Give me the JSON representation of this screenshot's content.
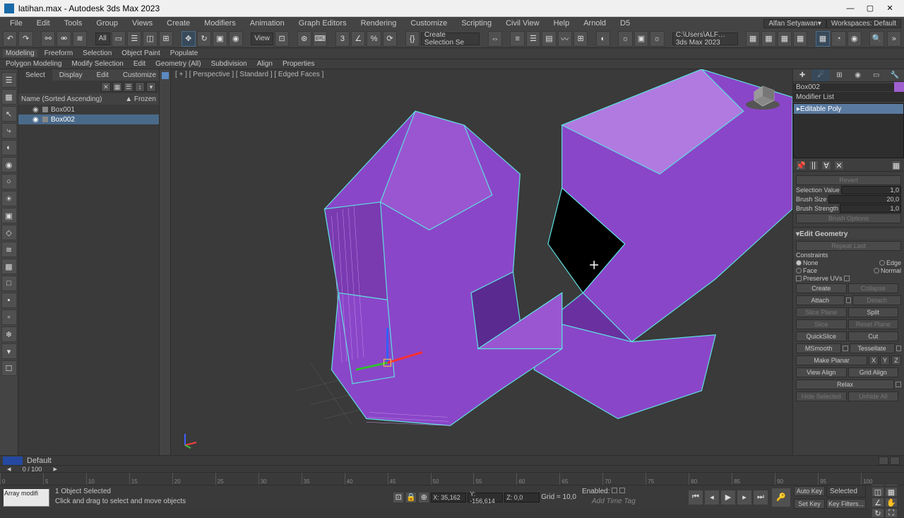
{
  "titlebar": {
    "title": "latihan.max - Autodesk 3ds Max 2023"
  },
  "menubar": {
    "items": [
      "File",
      "Edit",
      "Tools",
      "Group",
      "Views",
      "Create",
      "Modifiers",
      "Animation",
      "Graph Editors",
      "Rendering",
      "Customize",
      "Scripting",
      "Civil View",
      "Help",
      "Arnold",
      "D5"
    ],
    "user": "Alfan Setyawan",
    "workspace_label": "Workspaces:",
    "workspace_value": "Default"
  },
  "toolbar": {
    "filter_all": "All",
    "view": "View",
    "selection_set": "Create Selection Se",
    "path": "C:\\Users\\ALF… 3ds Max 2023"
  },
  "ribbon": {
    "tabs": [
      "Modeling",
      "Freeform",
      "Selection",
      "Object Paint",
      "Populate"
    ],
    "subtabs": [
      "Polygon Modeling",
      "Modify Selection",
      "Edit",
      "Geometry (All)",
      "Subdivision",
      "Align",
      "Properties"
    ]
  },
  "scene": {
    "tabs": [
      "Select",
      "Display",
      "Edit",
      "Customize"
    ],
    "header_name": "Name (Sorted Ascending)",
    "header_frozen": "▲ Frozen",
    "items": [
      {
        "name": "Box001",
        "selected": false
      },
      {
        "name": "Box002",
        "selected": true
      }
    ]
  },
  "viewport": {
    "label": "[ + ] [ Perspective ] [ Standard ] [ Edged Faces ]"
  },
  "modpanel": {
    "object_name": "Box002",
    "modlist_label": "Modifier List",
    "stack_item": "Editable Poly",
    "paint": {
      "revert": "Revert",
      "selval_label": "Selection Value",
      "selval": "1,0",
      "brushsize_label": "Brush Size",
      "brushsize": "20,0",
      "brushstr_label": "Brush Strength",
      "brushstr": "1,0",
      "brushopt": "Brush Options"
    },
    "editgeo": {
      "title": "Edit Geometry",
      "repeat": "Repeat Last",
      "constraints": "Constraints",
      "none": "None",
      "edge": "Edge",
      "face": "Face",
      "normal": "Normal",
      "preserve": "Preserve UVs",
      "create": "Create",
      "collapse": "Collapse",
      "attach": "Attach",
      "detach": "Detach",
      "sliceplane": "Slice Plane",
      "split": "Split",
      "slice": "Slice",
      "resetplane": "Reset Plane",
      "quickslice": "QuickSlice",
      "cut": "Cut",
      "msmooth": "MSmooth",
      "tessellate": "Tessellate",
      "makeplanar": "Make Planar",
      "x": "X",
      "y": "Y",
      "z": "Z",
      "viewalign": "View Align",
      "gridalign": "Grid Align",
      "relax": "Relax",
      "hidesel": "Hide Selected",
      "unhide": "Unhide All"
    }
  },
  "trackbar": {
    "frame": "0 / 100"
  },
  "timeline": {
    "ticks": [
      "0",
      "5",
      "10",
      "15",
      "20",
      "25",
      "30",
      "35",
      "40",
      "45",
      "50",
      "55",
      "60",
      "65",
      "70",
      "75",
      "80",
      "85",
      "90",
      "95",
      "100"
    ]
  },
  "prebar": {
    "default": "Default"
  },
  "status": {
    "mscript": "Array modifi",
    "selcount": "1 Object Selected",
    "hint": "Click and drag to select and move objects",
    "x": "X: 35,162",
    "y": "Y: -156,614",
    "z": "Z: 0,0",
    "grid": "Grid = 10,0",
    "enabled": "Enabled:",
    "addtag": "Add Time Tag",
    "autokey": "Auto Key",
    "selected": "Selected",
    "setkey": "Set Key",
    "keyfilters": "Key Filters..."
  }
}
